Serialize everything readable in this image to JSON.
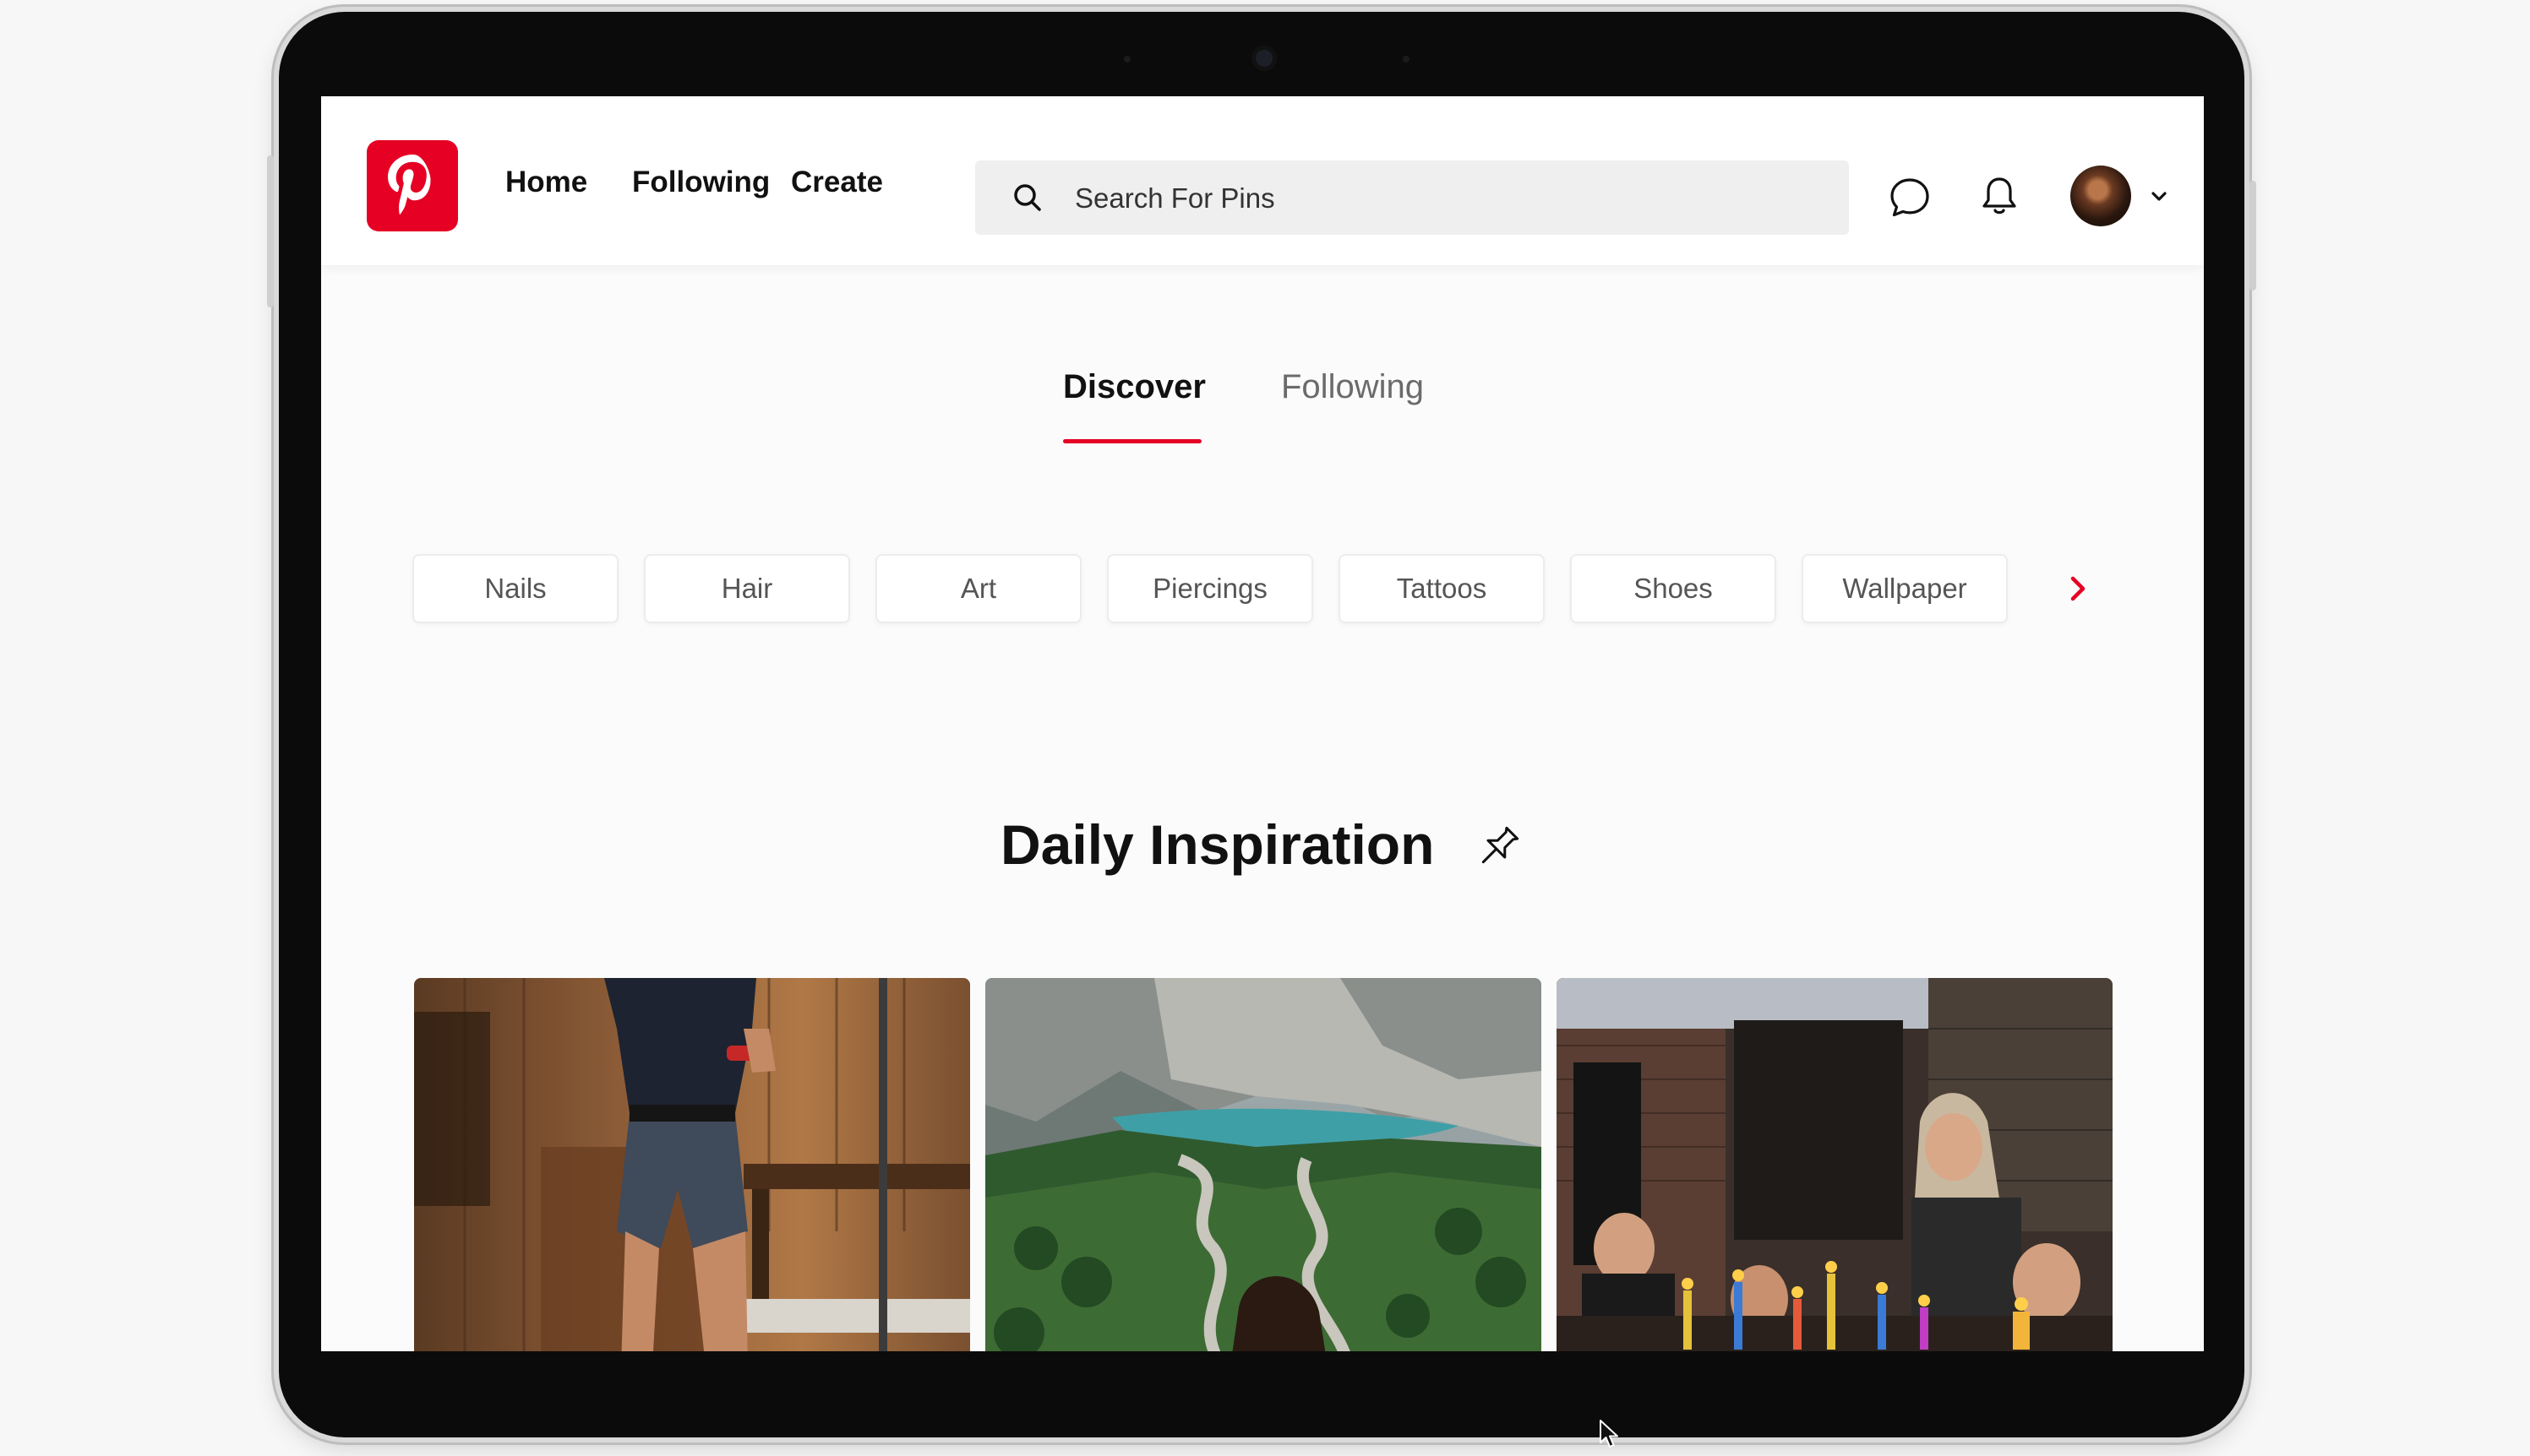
{
  "header": {
    "logo_name": "pinterest-logo",
    "nav_links": [
      "Home",
      "Following",
      "Create"
    ],
    "search_placeholder": "Search For Pins"
  },
  "tabs": [
    {
      "label": "Discover",
      "active": true
    },
    {
      "label": "Following",
      "active": false
    }
  ],
  "categories": [
    "Nails",
    "Hair",
    "Art",
    "Piercings",
    "Tattoos",
    "Shoes",
    "Wallpaper"
  ],
  "section": {
    "title": "Daily Inspiration"
  },
  "pins": [
    {
      "name": "pin-woman-denim-shorts"
    },
    {
      "name": "pin-mountain-road-lake"
    },
    {
      "name": "pin-candle-dinner-party"
    }
  ],
  "colors": {
    "brand": "#e60023",
    "text": "#111111",
    "muted": "#6b6b6b"
  }
}
